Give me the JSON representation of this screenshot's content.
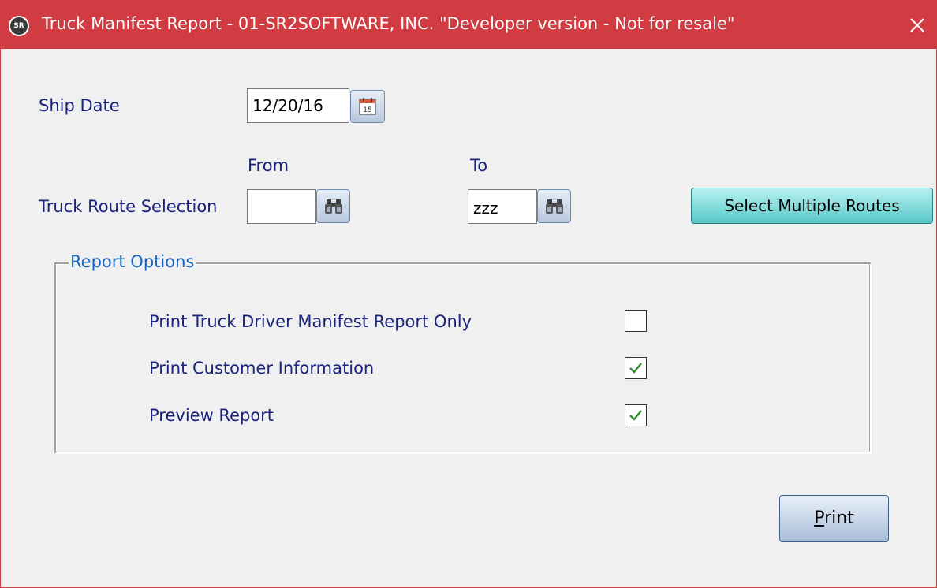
{
  "window": {
    "title": "Truck Manifest Report  -  01-SR2SOFTWARE, INC. \"Developer version - Not for resale\"",
    "app_icon_text": "SR",
    "titlebar_color": "#d13c42"
  },
  "ship_date": {
    "label": "Ship Date",
    "value": "12/20/16",
    "calendar_icon": "calendar-icon",
    "calendar_day": "15"
  },
  "route": {
    "label": "Truck Route Selection",
    "from_label": "From",
    "to_label": "To",
    "from_value": "",
    "to_value": "zzz",
    "lookup_icon": "binoculars-icon",
    "multi_button_label": "Select Multiple Routes"
  },
  "report_options": {
    "legend": "Report Options",
    "items": [
      {
        "label": "Print Truck Driver Manifest Report Only",
        "checked": false
      },
      {
        "label": "Print Customer Information",
        "checked": true
      },
      {
        "label": "Preview Report",
        "checked": true
      }
    ]
  },
  "print_button": {
    "mnemonic": "P",
    "rest": "rint"
  },
  "colors": {
    "label_text": "#1a237e",
    "legend_text": "#1565c0",
    "check_mark": "#2e8b2e",
    "multi_button": "#58c7c8"
  }
}
